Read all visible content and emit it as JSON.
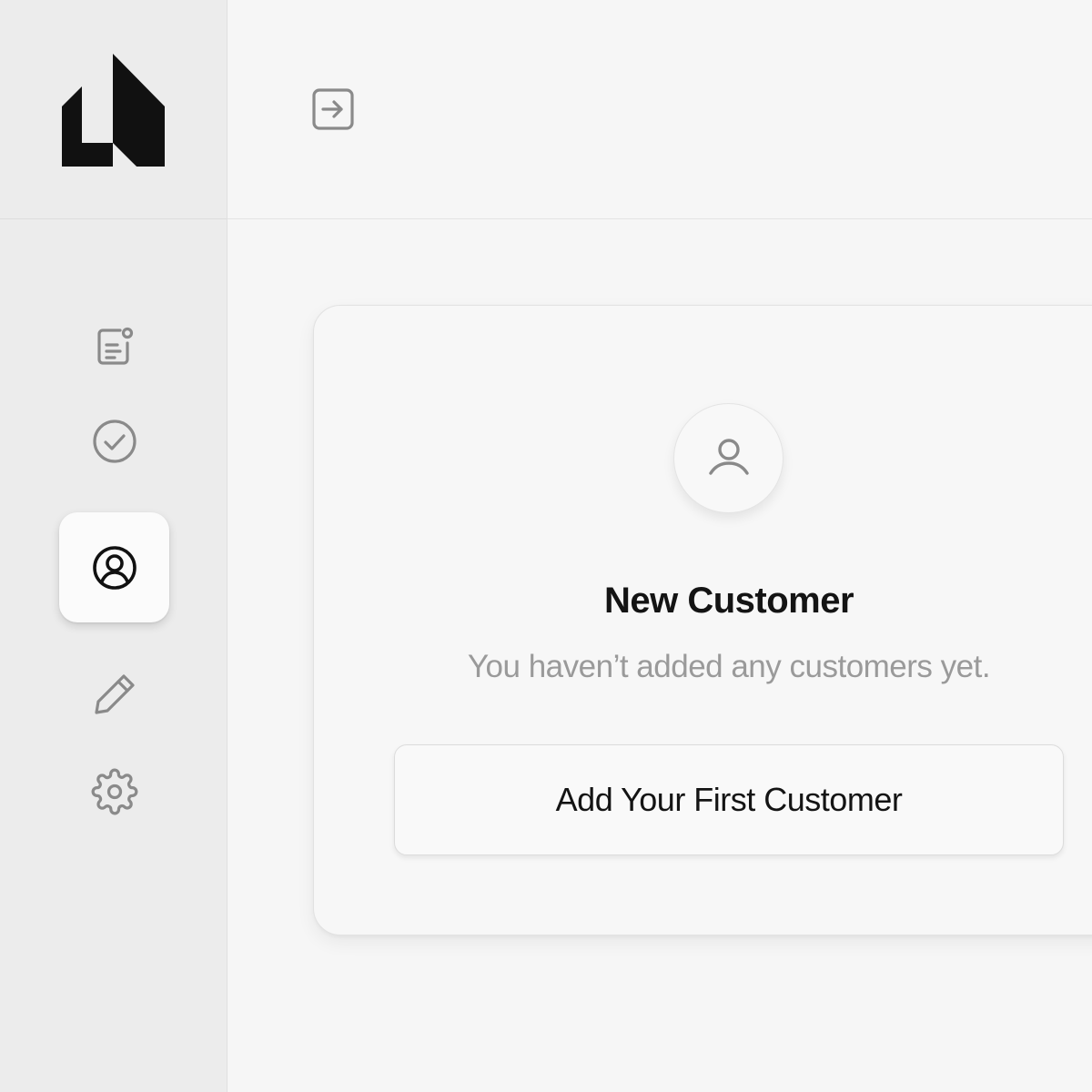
{
  "sidebar": {
    "logo": {
      "icon": "house-logo-icon",
      "color": "#111111"
    },
    "items": [
      {
        "icon": "notes-icon",
        "active": false
      },
      {
        "icon": "check-circle-icon",
        "active": false
      },
      {
        "icon": "user-circle-icon",
        "active": true
      },
      {
        "icon": "pencil-icon",
        "active": false
      },
      {
        "icon": "gear-icon",
        "active": false
      }
    ]
  },
  "topbar": {
    "expand_icon": "arrow-right-square-icon"
  },
  "empty_state": {
    "icon": "user-icon",
    "title": "New Customer",
    "subtitle": "You haven’t added any customers yet.",
    "button_label": "Add Your First Customer"
  },
  "colors": {
    "icon_muted": "#8a8a8a",
    "icon_active": "#111111",
    "text_primary": "#141414",
    "text_muted": "#9a9a9a"
  }
}
